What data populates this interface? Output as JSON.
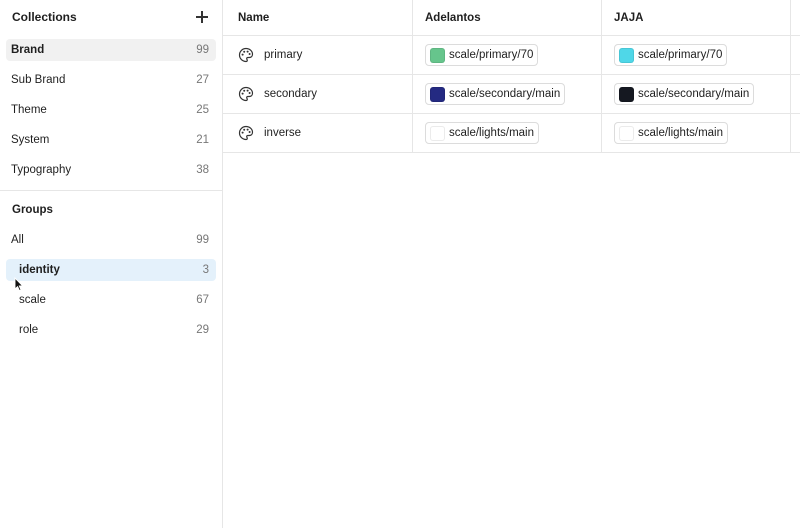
{
  "sidebar": {
    "title": "Collections",
    "collections": [
      {
        "label": "Brand",
        "count": "99"
      },
      {
        "label": "Sub Brand",
        "count": "27"
      },
      {
        "label": "Theme",
        "count": "25"
      },
      {
        "label": "System",
        "count": "21"
      },
      {
        "label": "Typography",
        "count": "38"
      }
    ],
    "groups_title": "Groups",
    "groups": [
      {
        "label": "All",
        "count": "99"
      },
      {
        "label": "identity",
        "count": "3"
      },
      {
        "label": "scale",
        "count": "67"
      },
      {
        "label": "role",
        "count": "29"
      }
    ]
  },
  "table": {
    "headers": [
      "Name",
      "Adelantos",
      "JAJA"
    ],
    "rows": [
      {
        "name": "primary",
        "a": {
          "text": "scale/primary/70",
          "color": "#66c58c"
        },
        "b": {
          "text": "scale/primary/70",
          "color": "#4fd7e8"
        }
      },
      {
        "name": "secondary",
        "a": {
          "text": "scale/secondary/main",
          "color": "#242a82"
        },
        "b": {
          "text": "scale/secondary/main",
          "color": "#151821"
        }
      },
      {
        "name": "inverse",
        "a": {
          "text": "scale/lights/main",
          "color": "#ffffff"
        },
        "b": {
          "text": "scale/lights/main",
          "color": "#ffffff"
        }
      }
    ]
  },
  "icons": {
    "add": "plus-icon",
    "row": "palette-icon",
    "pointer": "cursor-icon"
  }
}
